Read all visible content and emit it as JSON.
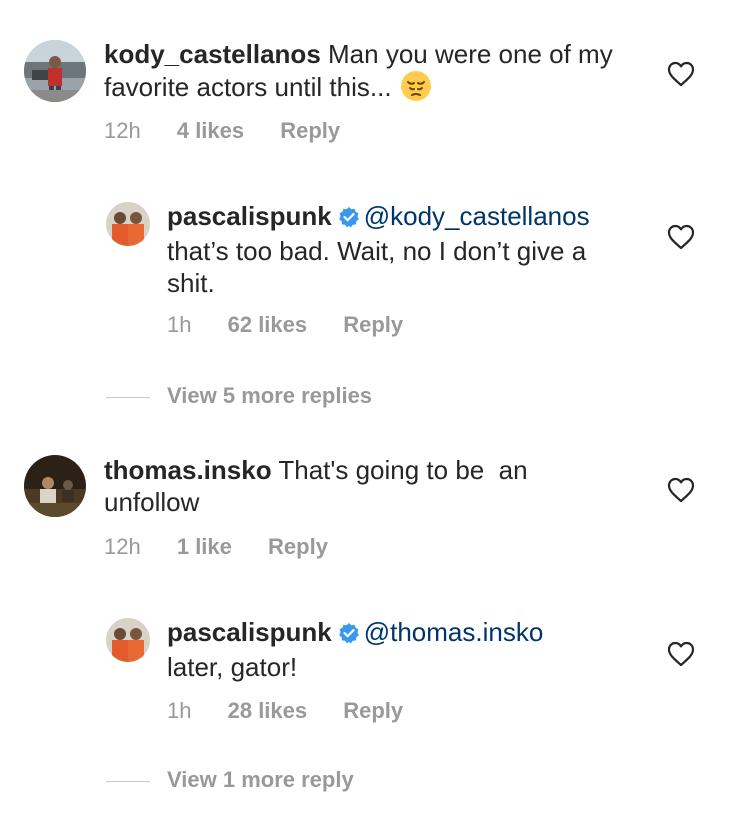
{
  "comments": [
    {
      "username": "kody_castellanos",
      "text": "Man you were one of my favorite actors until this...",
      "emoji": "pensive-face",
      "time": "12h",
      "likes": "4 likes",
      "reply": "Reply",
      "verified": false,
      "replies": [
        {
          "username": "pascalispunk",
          "verified": true,
          "mention": "@kody_castellanos",
          "text": "that’s too bad. Wait, no I don’t give a shit.",
          "time": "1h",
          "likes": "62 likes",
          "reply": "Reply"
        }
      ],
      "view_more": "View 5 more replies"
    },
    {
      "username": "thomas.insko",
      "text": "That's going to be  an unfollow",
      "time": "12h",
      "likes": "1 like",
      "reply": "Reply",
      "verified": false,
      "replies": [
        {
          "username": "pascalispunk",
          "verified": true,
          "mention": "@thomas.insko",
          "text": "later, gator!",
          "time": "1h",
          "likes": "28 likes",
          "reply": "Reply"
        }
      ],
      "view_more": "View 1 more reply"
    }
  ],
  "colors": {
    "text": "#262626",
    "meta": "#999999",
    "mention": "#003569",
    "verified": "#3897f0"
  }
}
